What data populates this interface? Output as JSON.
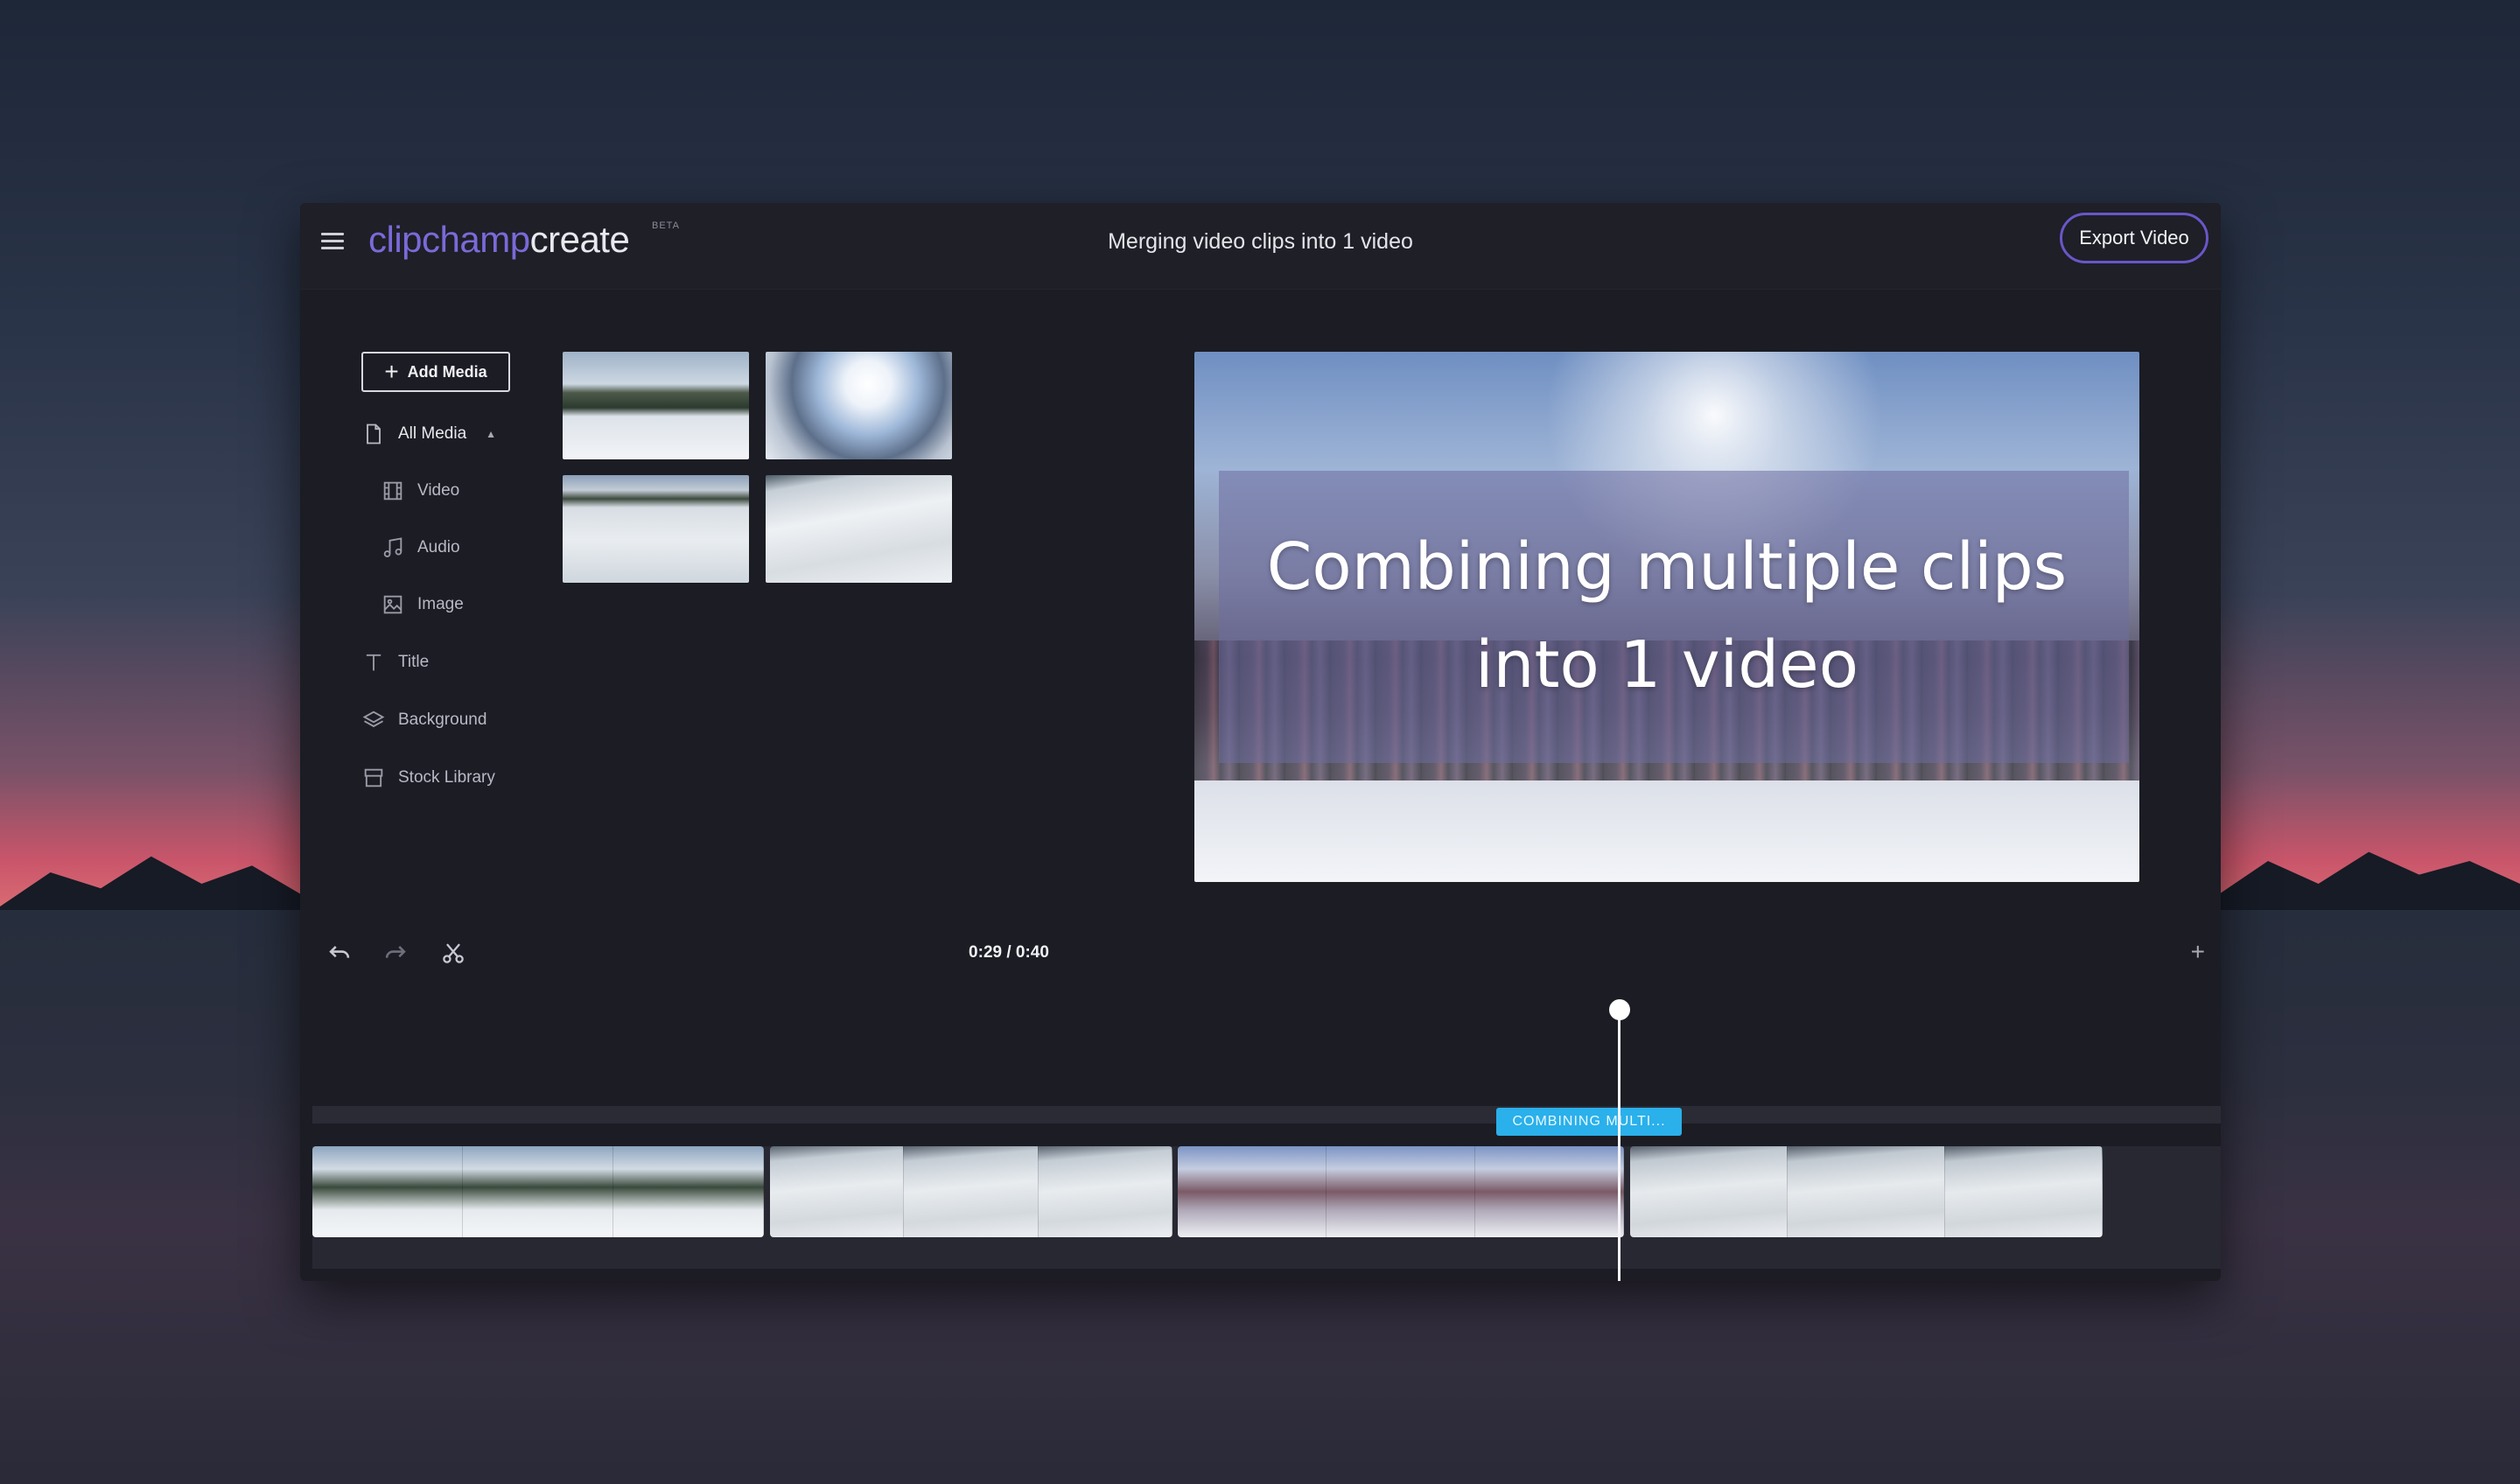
{
  "header": {
    "logo_part1": "clipchamp",
    "logo_part2": "create",
    "beta_badge": "BETA",
    "project_title": "Merging video clips into 1 video",
    "export_label": "Export Video"
  },
  "sidebar": {
    "add_media_label": "Add Media",
    "items": [
      {
        "label": "All Media",
        "icon": "file-icon"
      },
      {
        "label": "Video",
        "icon": "film-icon"
      },
      {
        "label": "Audio",
        "icon": "music-note-icon"
      },
      {
        "label": "Image",
        "icon": "image-icon"
      },
      {
        "label": "Title",
        "icon": "text-icon"
      },
      {
        "label": "Background",
        "icon": "layers-icon"
      },
      {
        "label": "Stock Library",
        "icon": "archive-box-icon"
      }
    ]
  },
  "preview": {
    "caption_line1": "Combining multiple clips",
    "caption_line2": "into 1 video"
  },
  "timeline": {
    "time_display": "0:29 / 0:40",
    "title_clip_label": "COMBINING MULTI...",
    "zoom_in_label": "+"
  },
  "colors": {
    "brand_purple": "#7a6ad8",
    "export_border": "#6a56c8",
    "title_clip_blue": "#2ab0ea",
    "app_background": "#1b1c24"
  }
}
